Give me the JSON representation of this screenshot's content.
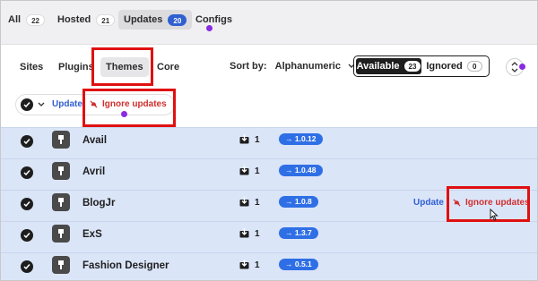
{
  "top_tabs": [
    {
      "label": "All",
      "count": "22",
      "active": false
    },
    {
      "label": "Hosted",
      "count": "21",
      "active": false
    },
    {
      "label": "Updates",
      "count": "20",
      "active": true
    },
    {
      "label": "Configs",
      "count": "",
      "active": false
    }
  ],
  "sub_tabs": [
    {
      "label": "Sites",
      "active": false
    },
    {
      "label": "Plugins",
      "active": false
    },
    {
      "label": "Themes",
      "active": true
    },
    {
      "label": "Core",
      "active": false
    }
  ],
  "sort": {
    "label": "Sort by:",
    "value": "Alphanumeric"
  },
  "availability_toggle": [
    {
      "label": "Available",
      "count": "23",
      "active": true
    },
    {
      "label": "Ignored",
      "count": "0",
      "active": false
    }
  ],
  "bulk_actions": {
    "update_label": "Update",
    "ignore_label": "Ignore updates"
  },
  "themes": [
    {
      "name": "Avail",
      "downloads": "1",
      "version": "→ 1.0.12"
    },
    {
      "name": "Avril",
      "downloads": "1",
      "version": "→ 1.0.48"
    },
    {
      "name": "BlogJr",
      "downloads": "1",
      "version": "→ 1.0.8",
      "update_label": "Update",
      "ignore_label": "Ignore updates"
    },
    {
      "name": "ExS",
      "downloads": "1",
      "version": "→ 1.3.7"
    },
    {
      "name": "Fashion Designer",
      "downloads": "1",
      "version": "→ 0.5.1"
    }
  ],
  "colors": {
    "accent_blue": "#2f5fd0",
    "danger_red": "#d12f2f",
    "highlight_red": "#e01010",
    "selected_row_bg": "#dbe5f8",
    "marker_purple": "#8a2be2"
  },
  "icons": [
    "check-icon",
    "chevron-down-icon",
    "bell-off-icon",
    "theme-brush-icon",
    "download-icon",
    "sort-arrows-icon",
    "cursor-icon"
  ]
}
